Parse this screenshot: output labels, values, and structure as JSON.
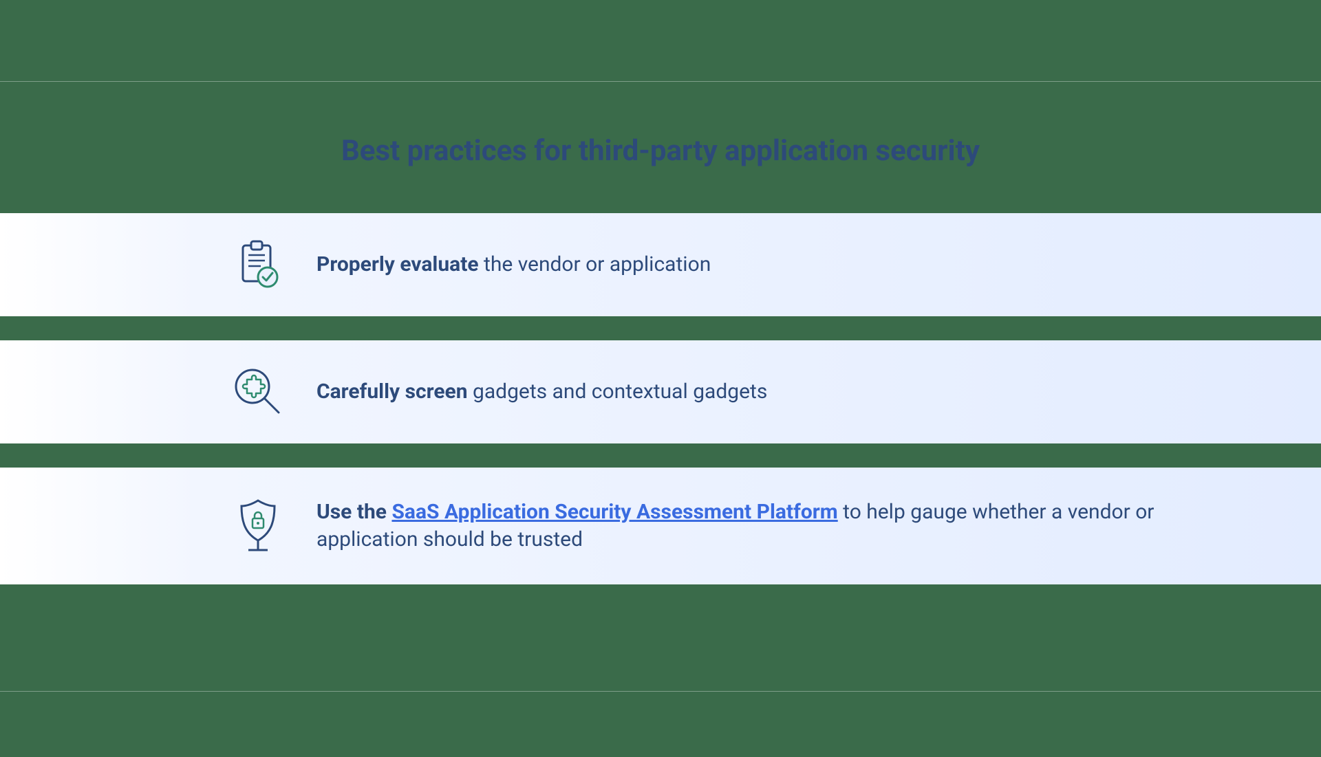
{
  "title": "Best practices for third-party application security",
  "cards": [
    {
      "icon": "clipboard-check-icon",
      "bold": "Properly evaluate",
      "rest": " the vendor or application"
    },
    {
      "icon": "magnify-puzzle-icon",
      "bold": "Carefully screen",
      "rest": " gadgets and contextual gadgets"
    },
    {
      "icon": "shield-lock-icon",
      "bold": "Use the ",
      "link": "SaaS Application Security Assessment Platform",
      "rest": " to help gauge whether a vendor or application should be trusted"
    }
  ],
  "colors": {
    "outline": "#2d4a7a",
    "accent": "#2e8b6f",
    "link": "#3a6be0"
  }
}
